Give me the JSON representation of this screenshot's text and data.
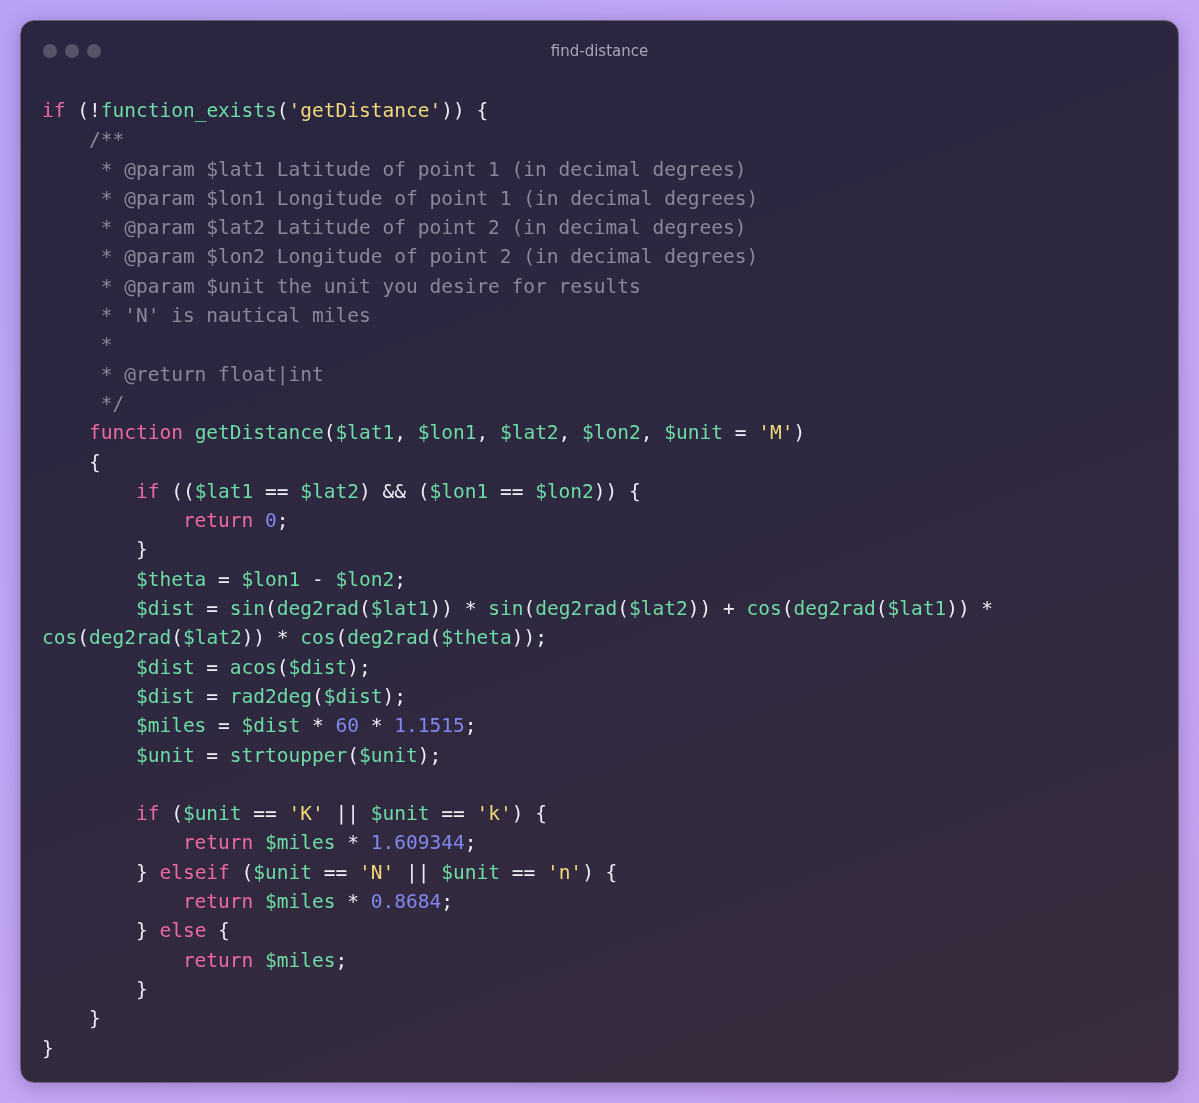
{
  "window": {
    "title": "find-distance"
  },
  "code_lines": [
    {
      "kind": "code",
      "tokens": [
        {
          "kind": "keyword",
          "text": "if"
        },
        {
          "kind": "plain",
          "text": " (!"
        },
        {
          "kind": "function",
          "text": "function_exists"
        },
        {
          "kind": "plain",
          "text": "("
        },
        {
          "kind": "string",
          "text": "'getDistance'"
        },
        {
          "kind": "plain",
          "text": ")) {"
        }
      ]
    },
    {
      "kind": "code",
      "tokens": [
        {
          "kind": "comment",
          "text": "    /**"
        }
      ]
    },
    {
      "kind": "code",
      "tokens": [
        {
          "kind": "comment",
          "text": "     * @param $lat1 Latitude of point 1 (in decimal degrees)"
        }
      ]
    },
    {
      "kind": "code",
      "tokens": [
        {
          "kind": "comment",
          "text": "     * @param $lon1 Longitude of point 1 (in decimal degrees)"
        }
      ]
    },
    {
      "kind": "code",
      "tokens": [
        {
          "kind": "comment",
          "text": "     * @param $lat2 Latitude of point 2 (in decimal degrees)"
        }
      ]
    },
    {
      "kind": "code",
      "tokens": [
        {
          "kind": "comment",
          "text": "     * @param $lon2 Longitude of point 2 (in decimal degrees)"
        }
      ]
    },
    {
      "kind": "code",
      "tokens": [
        {
          "kind": "comment",
          "text": "     * @param $unit the unit you desire for results"
        }
      ]
    },
    {
      "kind": "code",
      "tokens": [
        {
          "kind": "comment",
          "text": "     * 'N' is nautical miles"
        }
      ]
    },
    {
      "kind": "code",
      "tokens": [
        {
          "kind": "comment",
          "text": "     *"
        }
      ]
    },
    {
      "kind": "code",
      "tokens": [
        {
          "kind": "comment",
          "text": "     * @return float|int"
        }
      ]
    },
    {
      "kind": "code",
      "tokens": [
        {
          "kind": "comment",
          "text": "     */"
        }
      ]
    },
    {
      "kind": "code",
      "tokens": [
        {
          "kind": "keyword",
          "text": "    function"
        },
        {
          "kind": "function",
          "text": " getDistance"
        },
        {
          "kind": "plain",
          "text": "("
        },
        {
          "kind": "variable",
          "text": "$lat1"
        },
        {
          "kind": "plain",
          "text": ", "
        },
        {
          "kind": "variable",
          "text": "$lon1"
        },
        {
          "kind": "plain",
          "text": ", "
        },
        {
          "kind": "variable",
          "text": "$lat2"
        },
        {
          "kind": "plain",
          "text": ", "
        },
        {
          "kind": "variable",
          "text": "$lon2"
        },
        {
          "kind": "plain",
          "text": ", "
        },
        {
          "kind": "variable",
          "text": "$unit"
        },
        {
          "kind": "plain",
          "text": " = "
        },
        {
          "kind": "string",
          "text": "'M'"
        },
        {
          "kind": "plain",
          "text": ")"
        }
      ]
    },
    {
      "kind": "code",
      "tokens": [
        {
          "kind": "plain",
          "text": "    {"
        }
      ]
    },
    {
      "kind": "code",
      "tokens": [
        {
          "kind": "keyword",
          "text": "        if"
        },
        {
          "kind": "plain",
          "text": " (("
        },
        {
          "kind": "variable",
          "text": "$lat1"
        },
        {
          "kind": "plain",
          "text": " == "
        },
        {
          "kind": "variable",
          "text": "$lat2"
        },
        {
          "kind": "plain",
          "text": ") && ("
        },
        {
          "kind": "variable",
          "text": "$lon1"
        },
        {
          "kind": "plain",
          "text": " == "
        },
        {
          "kind": "variable",
          "text": "$lon2"
        },
        {
          "kind": "plain",
          "text": ")) {"
        }
      ]
    },
    {
      "kind": "code",
      "tokens": [
        {
          "kind": "keyword",
          "text": "            return"
        },
        {
          "kind": "number",
          "text": " 0"
        },
        {
          "kind": "plain",
          "text": ";"
        }
      ]
    },
    {
      "kind": "code",
      "tokens": [
        {
          "kind": "plain",
          "text": "        }"
        }
      ]
    },
    {
      "kind": "code",
      "tokens": [
        {
          "kind": "variable",
          "text": "        $theta"
        },
        {
          "kind": "plain",
          "text": " = "
        },
        {
          "kind": "variable",
          "text": "$lon1"
        },
        {
          "kind": "plain",
          "text": " - "
        },
        {
          "kind": "variable",
          "text": "$lon2"
        },
        {
          "kind": "plain",
          "text": ";"
        }
      ]
    },
    {
      "kind": "code",
      "tokens": [
        {
          "kind": "variable",
          "text": "        $dist"
        },
        {
          "kind": "plain",
          "text": " = "
        },
        {
          "kind": "function",
          "text": "sin"
        },
        {
          "kind": "plain",
          "text": "("
        },
        {
          "kind": "function",
          "text": "deg2rad"
        },
        {
          "kind": "plain",
          "text": "("
        },
        {
          "kind": "variable",
          "text": "$lat1"
        },
        {
          "kind": "plain",
          "text": ")) * "
        },
        {
          "kind": "function",
          "text": "sin"
        },
        {
          "kind": "plain",
          "text": "("
        },
        {
          "kind": "function",
          "text": "deg2rad"
        },
        {
          "kind": "plain",
          "text": "("
        },
        {
          "kind": "variable",
          "text": "$lat2"
        },
        {
          "kind": "plain",
          "text": ")) + "
        },
        {
          "kind": "function",
          "text": "cos"
        },
        {
          "kind": "plain",
          "text": "("
        },
        {
          "kind": "function",
          "text": "deg2rad"
        },
        {
          "kind": "plain",
          "text": "("
        },
        {
          "kind": "variable",
          "text": "$lat1"
        },
        {
          "kind": "plain",
          "text": ")) *"
        }
      ]
    },
    {
      "kind": "code",
      "tokens": [
        {
          "kind": "function",
          "text": "cos"
        },
        {
          "kind": "plain",
          "text": "("
        },
        {
          "kind": "function",
          "text": "deg2rad"
        },
        {
          "kind": "plain",
          "text": "("
        },
        {
          "kind": "variable",
          "text": "$lat2"
        },
        {
          "kind": "plain",
          "text": ")) * "
        },
        {
          "kind": "function",
          "text": "cos"
        },
        {
          "kind": "plain",
          "text": "("
        },
        {
          "kind": "function",
          "text": "deg2rad"
        },
        {
          "kind": "plain",
          "text": "("
        },
        {
          "kind": "variable",
          "text": "$theta"
        },
        {
          "kind": "plain",
          "text": "));"
        }
      ]
    },
    {
      "kind": "code",
      "tokens": [
        {
          "kind": "variable",
          "text": "        $dist"
        },
        {
          "kind": "plain",
          "text": " = "
        },
        {
          "kind": "function",
          "text": "acos"
        },
        {
          "kind": "plain",
          "text": "("
        },
        {
          "kind": "variable",
          "text": "$dist"
        },
        {
          "kind": "plain",
          "text": ");"
        }
      ]
    },
    {
      "kind": "code",
      "tokens": [
        {
          "kind": "variable",
          "text": "        $dist"
        },
        {
          "kind": "plain",
          "text": " = "
        },
        {
          "kind": "function",
          "text": "rad2deg"
        },
        {
          "kind": "plain",
          "text": "("
        },
        {
          "kind": "variable",
          "text": "$dist"
        },
        {
          "kind": "plain",
          "text": ");"
        }
      ]
    },
    {
      "kind": "code",
      "tokens": [
        {
          "kind": "variable",
          "text": "        $miles"
        },
        {
          "kind": "plain",
          "text": " = "
        },
        {
          "kind": "variable",
          "text": "$dist"
        },
        {
          "kind": "plain",
          "text": " * "
        },
        {
          "kind": "number",
          "text": "60"
        },
        {
          "kind": "plain",
          "text": " * "
        },
        {
          "kind": "number",
          "text": "1.1515"
        },
        {
          "kind": "plain",
          "text": ";"
        }
      ]
    },
    {
      "kind": "code",
      "tokens": [
        {
          "kind": "variable",
          "text": "        $unit"
        },
        {
          "kind": "plain",
          "text": " = "
        },
        {
          "kind": "function",
          "text": "strtoupper"
        },
        {
          "kind": "plain",
          "text": "("
        },
        {
          "kind": "variable",
          "text": "$unit"
        },
        {
          "kind": "plain",
          "text": ");"
        }
      ]
    },
    {
      "kind": "blank"
    },
    {
      "kind": "code",
      "tokens": [
        {
          "kind": "keyword",
          "text": "        if"
        },
        {
          "kind": "plain",
          "text": " ("
        },
        {
          "kind": "variable",
          "text": "$unit"
        },
        {
          "kind": "plain",
          "text": " == "
        },
        {
          "kind": "string",
          "text": "'K'"
        },
        {
          "kind": "plain",
          "text": " || "
        },
        {
          "kind": "variable",
          "text": "$unit"
        },
        {
          "kind": "plain",
          "text": " == "
        },
        {
          "kind": "string",
          "text": "'k'"
        },
        {
          "kind": "plain",
          "text": ") {"
        }
      ]
    },
    {
      "kind": "code",
      "tokens": [
        {
          "kind": "keyword",
          "text": "            return"
        },
        {
          "kind": "variable",
          "text": " $miles"
        },
        {
          "kind": "plain",
          "text": " * "
        },
        {
          "kind": "number",
          "text": "1.609344"
        },
        {
          "kind": "plain",
          "text": ";"
        }
      ]
    },
    {
      "kind": "code",
      "tokens": [
        {
          "kind": "plain",
          "text": "        } "
        },
        {
          "kind": "keyword",
          "text": "elseif"
        },
        {
          "kind": "plain",
          "text": " ("
        },
        {
          "kind": "variable",
          "text": "$unit"
        },
        {
          "kind": "plain",
          "text": " == "
        },
        {
          "kind": "string",
          "text": "'N'"
        },
        {
          "kind": "plain",
          "text": " || "
        },
        {
          "kind": "variable",
          "text": "$unit"
        },
        {
          "kind": "plain",
          "text": " == "
        },
        {
          "kind": "string",
          "text": "'n'"
        },
        {
          "kind": "plain",
          "text": ") {"
        }
      ]
    },
    {
      "kind": "code",
      "tokens": [
        {
          "kind": "keyword",
          "text": "            return"
        },
        {
          "kind": "variable",
          "text": " $miles"
        },
        {
          "kind": "plain",
          "text": " * "
        },
        {
          "kind": "number",
          "text": "0.8684"
        },
        {
          "kind": "plain",
          "text": ";"
        }
      ]
    },
    {
      "kind": "code",
      "tokens": [
        {
          "kind": "plain",
          "text": "        } "
        },
        {
          "kind": "keyword",
          "text": "else"
        },
        {
          "kind": "plain",
          "text": " {"
        }
      ]
    },
    {
      "kind": "code",
      "tokens": [
        {
          "kind": "keyword",
          "text": "            return"
        },
        {
          "kind": "variable",
          "text": " $miles"
        },
        {
          "kind": "plain",
          "text": ";"
        }
      ]
    },
    {
      "kind": "code",
      "tokens": [
        {
          "kind": "plain",
          "text": "        }"
        }
      ]
    },
    {
      "kind": "code",
      "tokens": [
        {
          "kind": "plain",
          "text": "    }"
        }
      ]
    },
    {
      "kind": "code",
      "tokens": [
        {
          "kind": "plain",
          "text": "}"
        }
      ]
    }
  ]
}
